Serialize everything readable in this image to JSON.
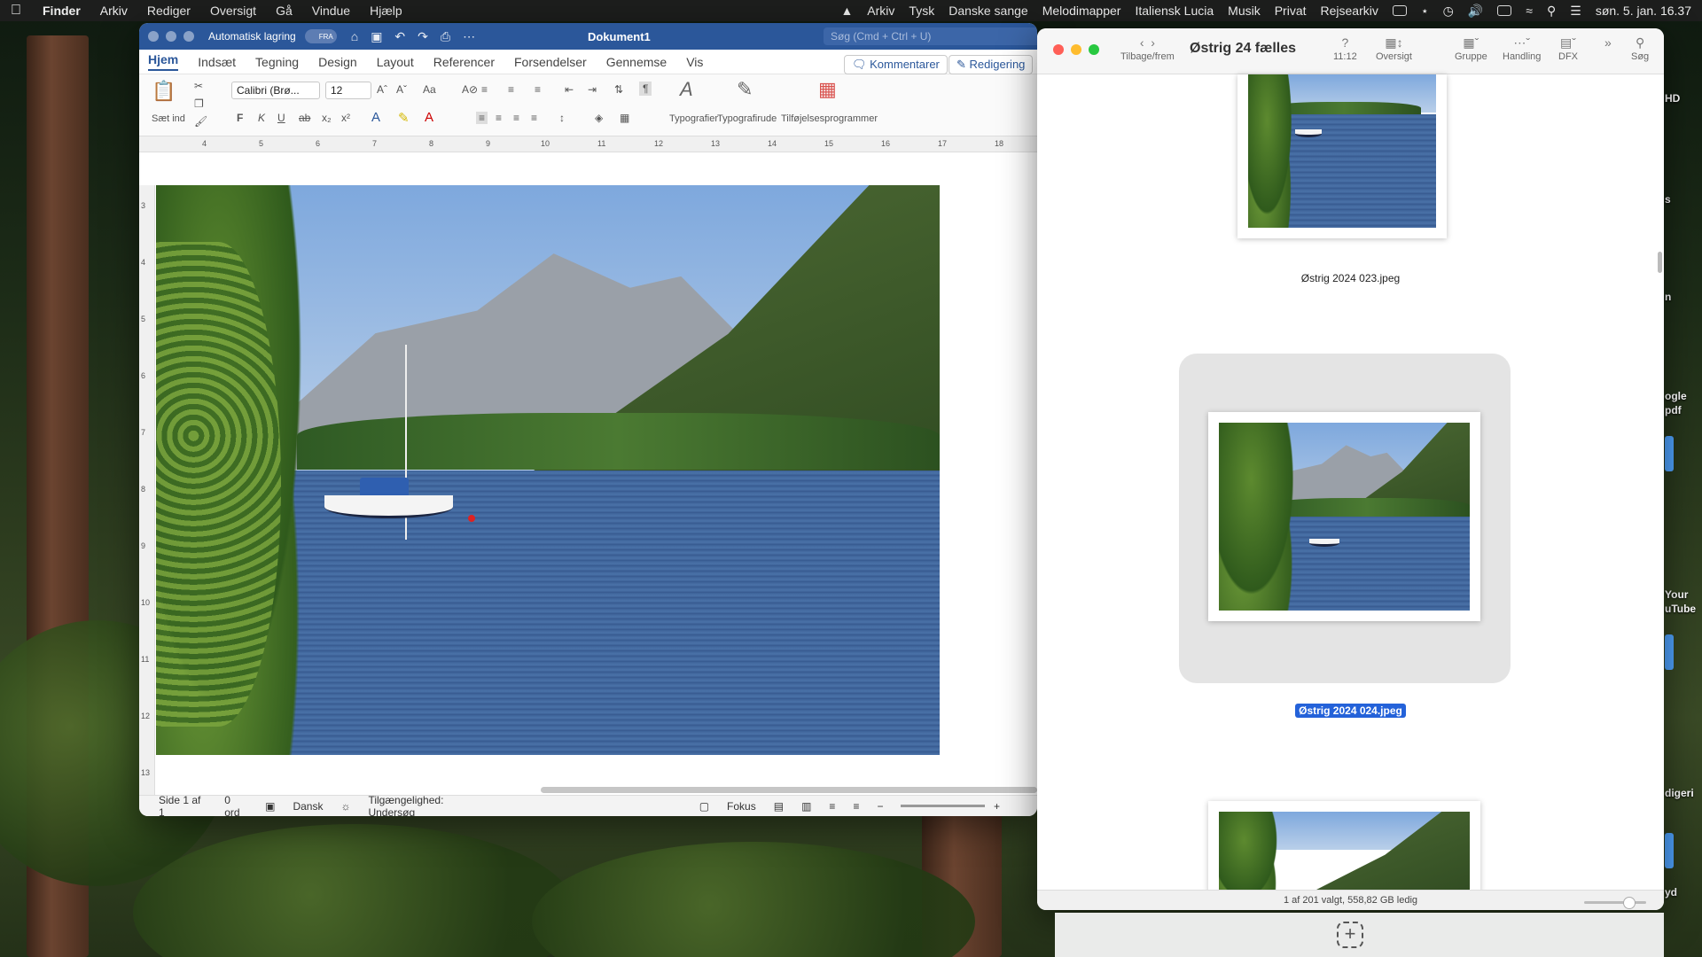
{
  "menubar": {
    "app": "Finder",
    "items": [
      "Arkiv",
      "Rediger",
      "Oversigt",
      "Gå",
      "Vindue",
      "Hjælp"
    ],
    "right_items": [
      "Arkiv",
      "Tysk",
      "Danske sange",
      "Melodimapper",
      "Italiensk Lucia",
      "Musik",
      "Privat",
      "Rejsearkiv"
    ],
    "clock": "søn. 5. jan. 16.37"
  },
  "word": {
    "autosave_label": "Automatisk lagring",
    "autosave_state": "FRA",
    "doc_title": "Dokument1",
    "search_placeholder": "Søg (Cmd + Ctrl + U)",
    "tabs": [
      "Hjem",
      "Indsæt",
      "Tegning",
      "Design",
      "Layout",
      "Referencer",
      "Forsendelser",
      "Gennemse",
      "Vis"
    ],
    "comments_button": "Kommentarer",
    "edit_button": "Redigering",
    "paste_label": "Sæt ind",
    "font_name": "Calibri (Brø...",
    "font_size": "12",
    "styles_label": "Typografier",
    "styles_pane_label": "Typografirude",
    "addins_label": "Tilføjelsesprogrammer",
    "ruler_numbers": [
      "4",
      "5",
      "6",
      "7",
      "8",
      "9",
      "10",
      "11",
      "12",
      "13",
      "14",
      "15",
      "16",
      "17",
      "18"
    ],
    "vruler_numbers": [
      "3",
      "4",
      "5",
      "6",
      "7",
      "8",
      "9",
      "10",
      "11",
      "12",
      "13"
    ],
    "status": {
      "page": "Side 1 af 1",
      "words": "0 ord",
      "language": "Dansk",
      "accessibility": "Tilgængelighed: Undersøg",
      "focus": "Fokus"
    }
  },
  "finder": {
    "title": "Østrig 24 fælles",
    "nav_label": "Tilbage/frem",
    "toolbar": {
      "help_label": "11:12",
      "view_label": "Oversigt",
      "group_label": "Gruppe",
      "action_label": "Handling",
      "dfx_label": "DFX",
      "search_label": "Søg"
    },
    "files": [
      {
        "name": "Østrig 2024 023.jpeg",
        "selected": false
      },
      {
        "name": "Østrig 2024 024.jpeg",
        "selected": true
      }
    ],
    "status": "1 af 201 valgt, 558,82 GB ledig"
  },
  "desktop": {
    "labels": [
      "HD",
      "s",
      "n",
      "ogle",
      "pdf",
      "Your",
      "uTube",
      "digeri",
      "yd"
    ]
  }
}
